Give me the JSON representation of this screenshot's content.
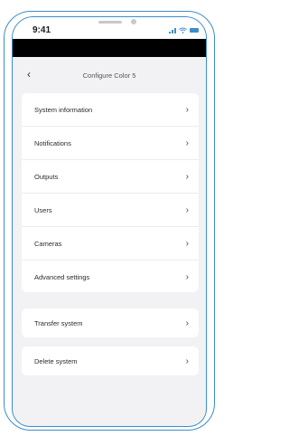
{
  "status_bar": {
    "time": "9:41"
  },
  "nav": {
    "back_icon": "‹",
    "title": "Configure Color 5"
  },
  "chevron": "›",
  "menu_groups": [
    {
      "items": [
        "System information",
        "Notifications",
        "Outputs",
        "Users",
        "Cameras",
        "Advanced settings"
      ]
    },
    {
      "items": [
        "Transfer system"
      ]
    },
    {
      "items": [
        "Delete system"
      ]
    }
  ],
  "colors": {
    "frame": "#3d8dc9",
    "background": "#f2f2f4",
    "card": "#ffffff"
  }
}
